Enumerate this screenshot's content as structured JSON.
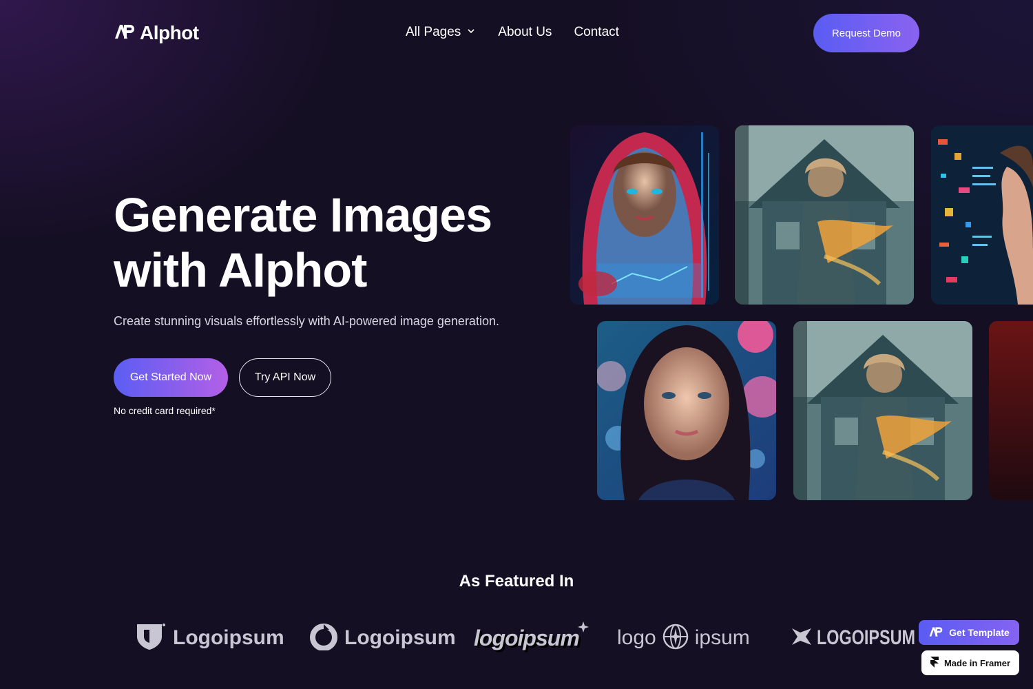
{
  "nav": {
    "logo_text": "Alphot",
    "links": [
      {
        "label": "All Pages",
        "has_dropdown": true
      },
      {
        "label": "About Us"
      },
      {
        "label": "Contact"
      }
    ],
    "cta_label": "Request Demo"
  },
  "hero": {
    "title_line1": "Generate Images",
    "title_line2": "with AIphot",
    "subtitle": "Create stunning visuals effortlessly with AI-powered image generation.",
    "primary_button": "Get Started Now",
    "secondary_button": "Try API Now",
    "note": "No credit card required*"
  },
  "gallery": {
    "images": [
      {
        "name": "hooded-woman-tech-image"
      },
      {
        "name": "woman-house-double-exposure-image"
      },
      {
        "name": "woman-code-lights-image"
      },
      {
        "name": "woman-portrait-bokeh-image"
      },
      {
        "name": "woman-house-double-exposure-image-2"
      },
      {
        "name": "red-partial-image"
      }
    ]
  },
  "featured": {
    "title": "As Featured In",
    "brands": [
      {
        "text": "Logoipsum",
        "icon": "shield-logo-icon"
      },
      {
        "text": "Logoipsum",
        "icon": "ring-logo-icon"
      },
      {
        "text": "logoipsum",
        "icon": "star-sparkle-icon"
      },
      {
        "text_left": "logo",
        "text_right": "ipsum",
        "icon": "globe-logo-icon"
      },
      {
        "text": "LOGOIPSUM",
        "icon": "bird-logo-icon"
      }
    ]
  },
  "badges": {
    "template": "Get Template",
    "framer": "Made in Framer"
  },
  "colors": {
    "background": "#150f24",
    "accent_start": "#5a5cf2",
    "accent_end": "#b35fe6"
  }
}
